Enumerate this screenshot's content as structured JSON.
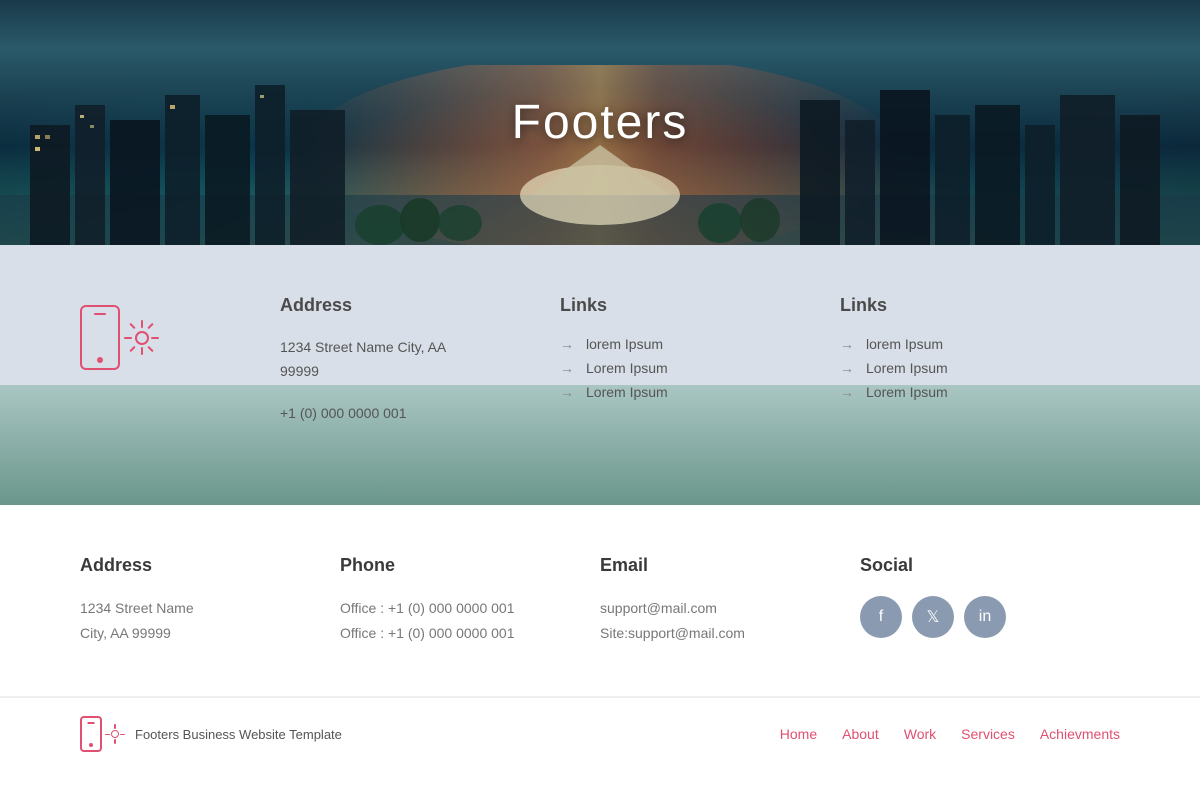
{
  "hero": {
    "title": "Footers"
  },
  "footer1": {
    "address_title": "Address",
    "address_line1": "1234 Street Name City, AA",
    "address_line2": "99999",
    "phone": "+1 (0) 000 0000 001",
    "links1_title": "Links",
    "links1": [
      "lorem Ipsum",
      "Lorem Ipsum",
      "Lorem Ipsum"
    ],
    "links2_title": "Links",
    "links2": [
      "lorem Ipsum",
      "Lorem Ipsum",
      "Lorem Ipsum"
    ]
  },
  "footer2": {
    "address_title": "Address",
    "address_line1": "1234 Street Name",
    "address_line2": "City, AA 99999",
    "phone_title": "Phone",
    "phone_line1": "Office : +1 (0) 000 0000 001",
    "phone_line2": "Office : +1 (0) 000 0000 001",
    "email_title": "Email",
    "email_line1": "support@mail.com",
    "email_line2": "Site:support@mail.com",
    "social_title": "Social"
  },
  "bottom": {
    "brand": "Footers Business Website Template",
    "nav": [
      "Home",
      "About",
      "Work",
      "Services",
      "Achievments"
    ]
  }
}
